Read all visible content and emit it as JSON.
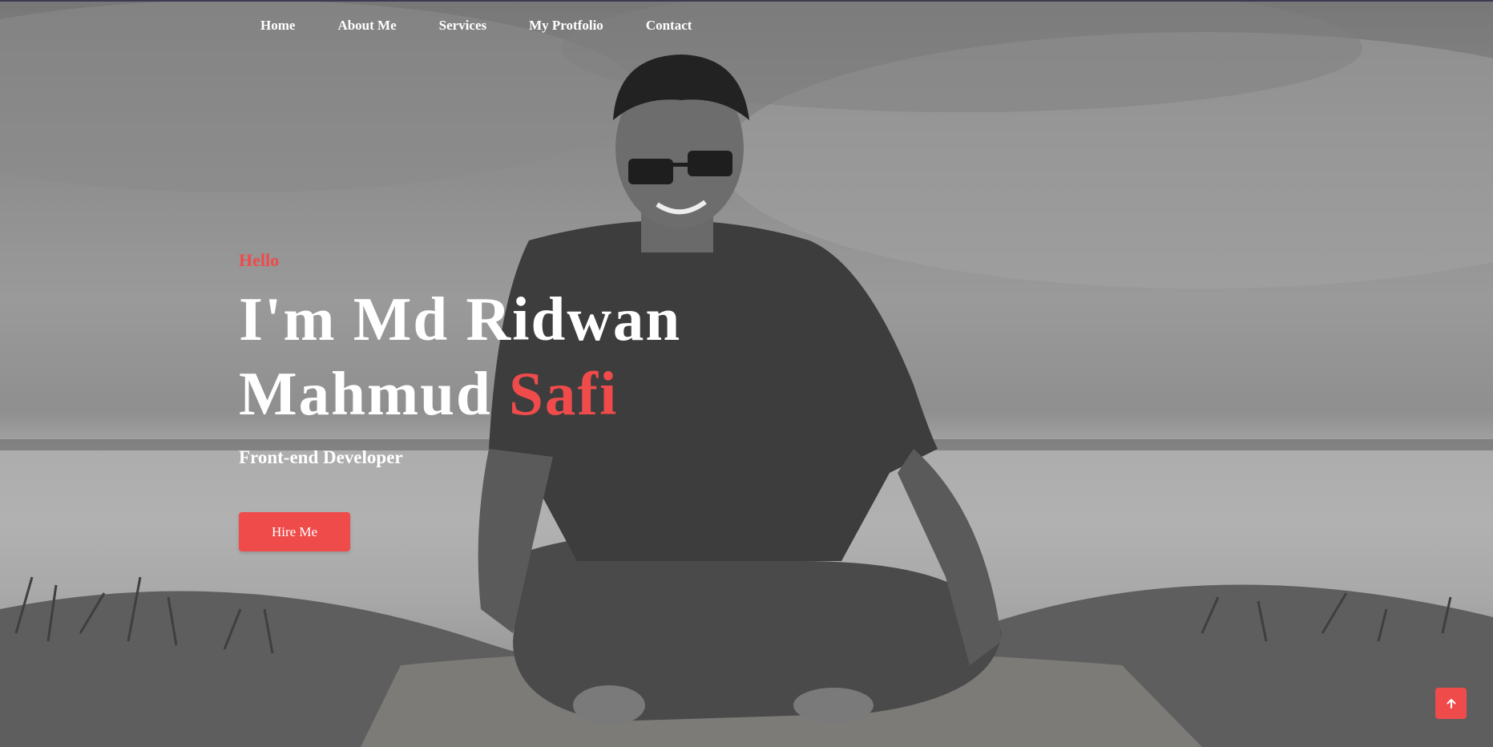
{
  "nav": {
    "items": [
      {
        "label": "Home"
      },
      {
        "label": "About Me"
      },
      {
        "label": "Services"
      },
      {
        "label": "My Protfolio"
      },
      {
        "label": "Contact"
      }
    ]
  },
  "hero": {
    "greeting": "Hello",
    "name_line1": "I'm Md Ridwan",
    "name_line2": "Mahmud",
    "name_accent": "Safi",
    "role": "Front-end Developer",
    "cta_label": "Hire Me",
    "photo_description_icon": "person-photo",
    "scroll_top_icon": "arrow-up-icon"
  },
  "colors": {
    "accent": "#ef4b4b",
    "text": "#ffffff"
  }
}
